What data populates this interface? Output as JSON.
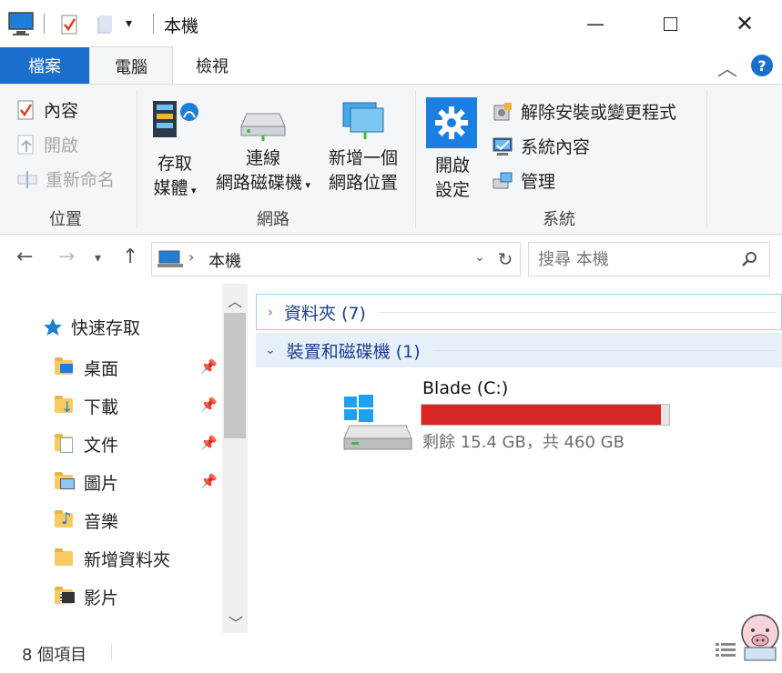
{
  "window": {
    "title": "本機"
  },
  "tabs": {
    "file": "檔案",
    "computer": "電腦",
    "view": "檢視"
  },
  "ribbon": {
    "location": {
      "label": "位置",
      "properties": "內容",
      "open": "開啟",
      "rename": "重新命名"
    },
    "network": {
      "label": "網路",
      "access_media_l1": "存取",
      "access_media_l2": "媒體",
      "map_drive_l1": "連線",
      "map_drive_l2": "網路磁碟機",
      "add_location_l1": "新增一個",
      "add_location_l2": "網路位置"
    },
    "system": {
      "label": "系統",
      "open_settings_l1": "開啟",
      "open_settings_l2": "設定",
      "uninstall": "解除安裝或變更程式",
      "system_properties": "系統內容",
      "manage": "管理"
    }
  },
  "address": {
    "path": "本機",
    "search_placeholder": "搜尋 本機"
  },
  "nav": {
    "quick_access": "快速存取",
    "items": [
      {
        "label": "桌面",
        "pinned": true
      },
      {
        "label": "下載",
        "pinned": true
      },
      {
        "label": "文件",
        "pinned": true
      },
      {
        "label": "圖片",
        "pinned": true
      },
      {
        "label": "音樂",
        "pinned": false
      },
      {
        "label": "新增資料夾",
        "pinned": false
      },
      {
        "label": "影片",
        "pinned": false
      }
    ]
  },
  "content": {
    "folders_group": "資料夾 (7)",
    "devices_group": "裝置和磁碟機 (1)",
    "drive": {
      "name": "Blade (C:)",
      "free_text": "剩餘 15.4 GB，共 460 GB",
      "used_fraction": 0.967,
      "bar_color": "#da2626"
    }
  },
  "status": {
    "count": "8 個項目"
  },
  "colors": {
    "accent": "#1a6fcc",
    "selected_group": "#cce8ff"
  }
}
